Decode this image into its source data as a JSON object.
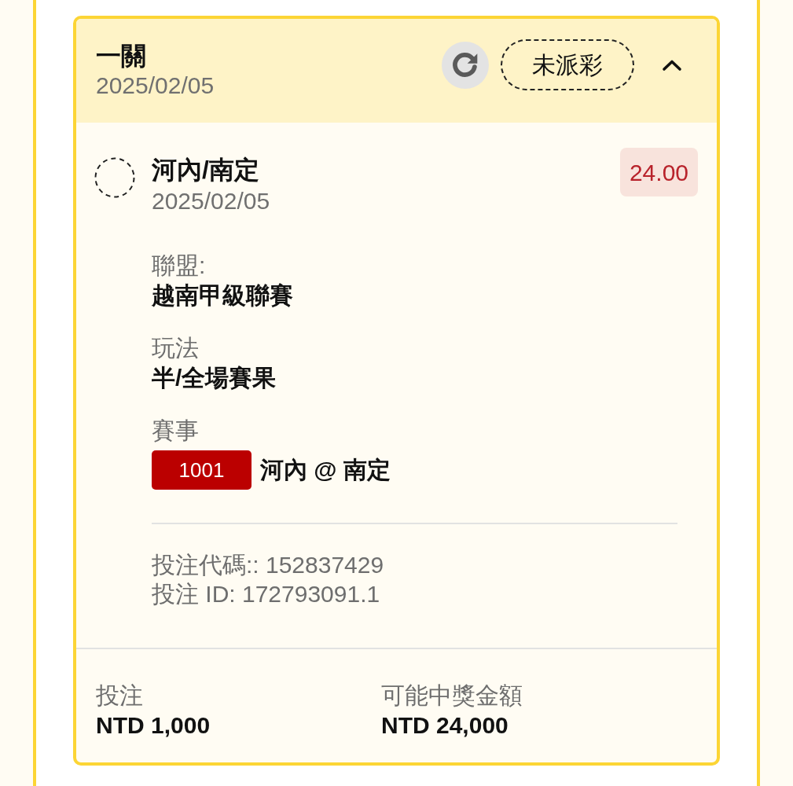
{
  "bet": {
    "title": "一關",
    "date": "2025/02/05",
    "status": "未派彩",
    "expanded": true,
    "selection": {
      "title": "河內/南定",
      "date": "2025/02/05",
      "odds": "24.00",
      "details": [
        {
          "kind": "text",
          "label": "聯盟:",
          "value": "越南甲級聯賽"
        },
        {
          "kind": "text",
          "label": "玩法",
          "value": "半/全場賽果"
        },
        {
          "kind": "match",
          "label": "賽事",
          "code": "1001",
          "value": "河內 @ 南定"
        }
      ],
      "references": [
        "投注代碼:: 152837429",
        "投注 ID: 172793091.1"
      ]
    },
    "summary": [
      {
        "label": "投注",
        "value": "NTD 1,000"
      },
      {
        "label": "可能中獎金額",
        "value": "NTD 24,000"
      }
    ]
  }
}
